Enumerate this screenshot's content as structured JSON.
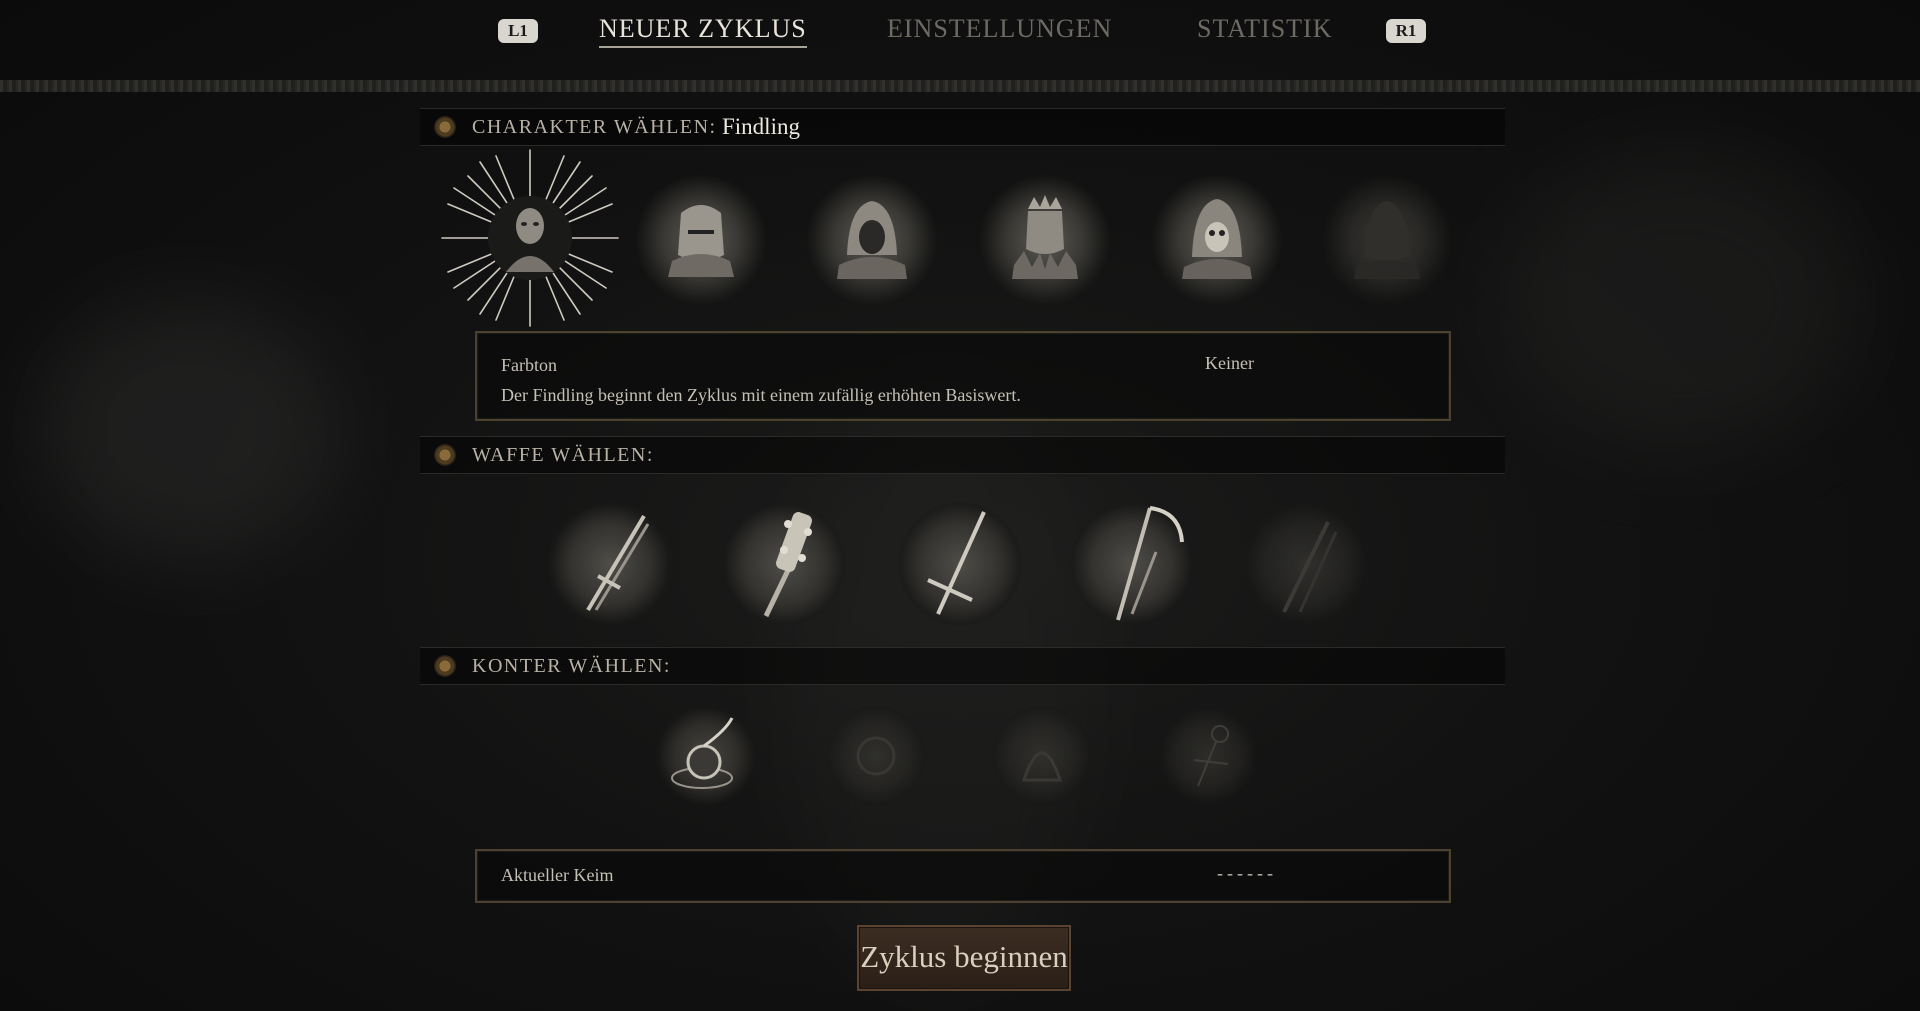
{
  "nav": {
    "left_button": "L1",
    "right_button": "R1",
    "tabs": [
      {
        "label": "NEUER ZYKLUS",
        "active": true
      },
      {
        "label": "EINSTELLUNGEN",
        "active": false
      },
      {
        "label": "STATISTIK",
        "active": false
      }
    ]
  },
  "character": {
    "header": "CHARAKTER WÄHLEN:",
    "selected": "Findling",
    "portraits": [
      "findling-portrait",
      "knight-helm-portrait",
      "hooded-portrait",
      "crowned-portrait",
      "skull-hood-portrait",
      "locked-portrait"
    ],
    "info": {
      "label": "Farbton",
      "value": "Keiner",
      "description": "Der Findling beginnt den Zyklus mit einem zufällig erhöhten Basiswert."
    }
  },
  "weapon": {
    "header": "WAFFE WÄHLEN:",
    "items": [
      "twin-blade-icon",
      "spiked-mace-icon",
      "longsword-icon",
      "scythe-icon",
      "locked-weapon-icon"
    ]
  },
  "counter": {
    "header": "KONTER WÄHLEN:",
    "items": [
      "spiral-counter-icon",
      "locked-counter-icon-1",
      "locked-counter-icon-2",
      "locked-counter-icon-3"
    ]
  },
  "seed": {
    "label": "Aktueller Keim",
    "value": "------"
  },
  "start_button": "Zyklus beginnen",
  "colors": {
    "background": "#121212",
    "accent_gold": "#8a7650",
    "button_brown": "#3c2d22"
  }
}
